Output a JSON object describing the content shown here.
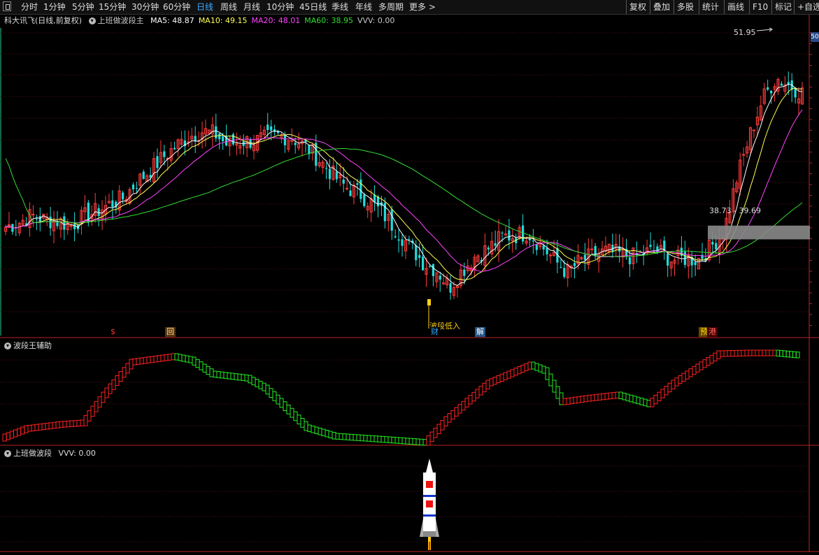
{
  "toolbar": {
    "periods": [
      "分时",
      "1分钟",
      "5分钟",
      "15分钟",
      "30分钟",
      "60分钟",
      "日线",
      "周线",
      "月线",
      "10分钟",
      "45日线",
      "季线",
      "年线",
      "多周期",
      "更多 >"
    ],
    "active_period": "日线",
    "right_buttons": [
      "复权",
      "叠加",
      "多股",
      "统计",
      "画线",
      "F10",
      "标记",
      "+自选"
    ]
  },
  "main_panel": {
    "stock_title": "科大讯飞(日线,前复权)",
    "indicator_name": "上班做波段主",
    "ma_labels": [
      {
        "text": "MA5: 48.87",
        "color": "#ffffff"
      },
      {
        "text": "MA10: 49.15",
        "color": "#ffff55"
      },
      {
        "text": "MA20: 48.01",
        "color": "#ff44ff"
      },
      {
        "text": "MA60: 38.95",
        "color": "#33dd33"
      },
      {
        "text": "VVV: 0.00",
        "color": "#c8c8c8"
      }
    ],
    "high_label": "51.95",
    "low_label": "波段低入",
    "range_label": "38.73 - 39.69",
    "right_tag": "50",
    "event_tags": [
      {
        "text": "$",
        "color": "#ff3333",
        "bg": "#000000"
      },
      {
        "text": "回",
        "color": "#ffdd88",
        "bg": "#553311"
      },
      {
        "text": "财",
        "color": "#33aaff",
        "bg": "#000000"
      },
      {
        "text": "解",
        "color": "#ffffff",
        "bg": "#225588"
      },
      {
        "text": "预",
        "color": "#ffdd00",
        "bg": "#664400"
      },
      {
        "text": "港",
        "color": "#ff6666",
        "bg": "#440000"
      }
    ]
  },
  "sub_panel_1": {
    "title": "波段王辅助"
  },
  "sub_panel_2": {
    "title": "上班做波段",
    "value_label": "VVV: 0.00"
  },
  "colors": {
    "up": "#ff3c3c",
    "down": "#22dddd",
    "ma5": "#ffffff",
    "ma10": "#ffff55",
    "ma20": "#ff44ff",
    "ma60": "#33dd33",
    "band_up": "#ff2222",
    "band_down": "#22ee22"
  },
  "chart_data": {
    "type": "candlestick",
    "title": "",
    "price_range": [
      32.5,
      53.5
    ],
    "sample_closes": [
      39.6,
      39.9,
      40.4,
      40.1,
      40.0,
      39.7,
      40.3,
      40.7,
      41.2,
      41.6,
      42.7,
      43.5,
      44.4,
      45.2,
      45.9,
      46.3,
      46.1,
      45.3,
      45.6,
      45.6,
      45.8,
      46.0,
      45.8,
      45.2,
      44.3,
      43.3,
      42.4,
      42.0,
      41.3,
      40.4,
      39.3,
      38.2,
      37.1,
      36.6,
      35.4,
      36.6,
      37.6,
      38.1,
      38.9,
      39.0,
      39.2,
      38.3,
      37.3,
      36.4,
      37.2,
      37.6,
      37.9,
      37.7,
      37.5,
      37.8,
      37.9,
      37.3,
      37.4,
      37.3,
      38.2,
      39.3,
      43.0,
      46.0,
      48.6,
      50.0,
      49.5,
      49.0
    ],
    "annotations": {
      "high": 51.95,
      "low_zone": [
        38.73,
        39.69
      ]
    }
  }
}
